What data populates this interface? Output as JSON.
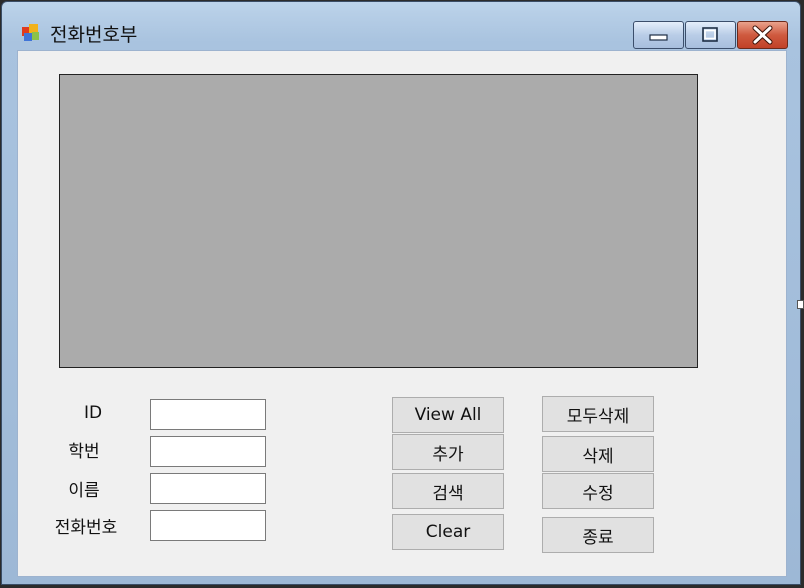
{
  "window": {
    "title": "전화번호부",
    "icon": "app-windows-icon",
    "caption_buttons": [
      "minimize-icon",
      "maximize-icon",
      "close-icon"
    ]
  },
  "form": {
    "labels": {
      "id": "ID",
      "student_no": "학번",
      "name": "이름",
      "phone": "전화번호"
    },
    "fields": {
      "id": "",
      "student_no": "",
      "name": "",
      "phone": ""
    }
  },
  "buttons": {
    "view_all": "View All",
    "add": "추가",
    "search": "검색",
    "clear": "Clear",
    "delete_all": "모두삭제",
    "delete": "삭제",
    "edit": "수정",
    "exit": "종료"
  },
  "colors": {
    "grid_background": "#ababab",
    "close_button": "#c9503a",
    "form_background": "#f0f0f0"
  }
}
